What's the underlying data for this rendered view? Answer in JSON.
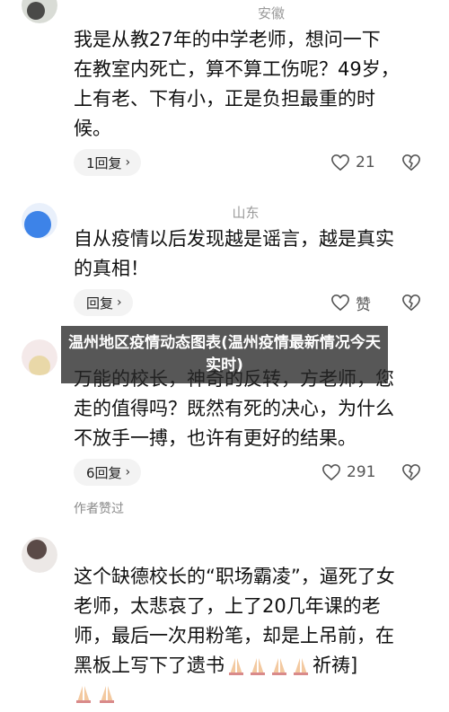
{
  "colors": {
    "pill_bg": "#f3f3f3",
    "meta_text": "#9a9a9a",
    "banner_bg": "#282828"
  },
  "comments": [
    {
      "meta_location": "安徽",
      "body_lines": [
        "我是从教27年的中学老师，想问一下",
        "在教室内死亡，算不算工伤呢？49岁，",
        "上有老、下有小，正是负担最重的时",
        "候。"
      ],
      "reply_label": "1回复",
      "likes": "21"
    },
    {
      "meta_location": "山东",
      "body_lines": [
        "自从疫情以后发现越是谣言，越是真实",
        "的真相！"
      ],
      "reply_label": "回复",
      "likes": "赞"
    },
    {
      "body_lines": [
        "万能的校长，神奇的反转，方老师，您",
        "走的值得吗？既然有死的决心，为什么",
        "不放手一搏，也许有更好的结果。"
      ],
      "reply_label": "6回复",
      "likes": "291",
      "author_liked": "作者赞过"
    },
    {
      "body_lines": [
        "这个缺德校长的“职场霸凌”，逼死了女",
        "老师，太悲哀了，上了20几年课的老",
        "师，最后一次用粉笔，却是上吊前，在",
        "黑板上写下了遗书",
        "祈祷]"
      ]
    }
  ],
  "banner": {
    "title": "温州地区疫情动态图表(温州疫情最新情况今天实时)"
  },
  "icons": [
    "heart-icon",
    "broken-heart-icon",
    "chevron-right-icon",
    "praying-hands-icon"
  ]
}
